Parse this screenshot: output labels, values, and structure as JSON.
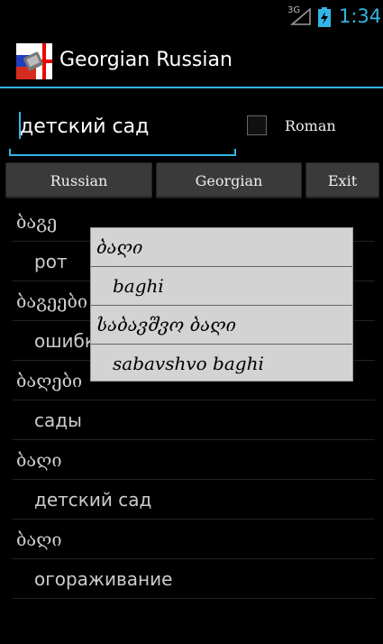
{
  "status_bar": {
    "network": "3G",
    "time": "1:34",
    "signal_icon": "signal-icon",
    "battery_icon": "battery-charging-icon"
  },
  "app": {
    "title": "Georgian Russian",
    "icon": "app-flag-icon"
  },
  "search": {
    "value": "детский сад",
    "roman_label": "Roman",
    "roman_checked": false
  },
  "buttons": {
    "russian": "Russian",
    "georgian": "Georgian",
    "exit": "Exit"
  },
  "results": [
    {
      "type": "geo",
      "text": "ბაგე"
    },
    {
      "type": "rus",
      "text": "рот"
    },
    {
      "type": "geo",
      "text": "ბაგეები"
    },
    {
      "type": "rus",
      "text": "ошибки"
    },
    {
      "type": "geo",
      "text": "ბაღები"
    },
    {
      "type": "rus",
      "text": "сады"
    },
    {
      "type": "geo",
      "text": "ბაღი"
    },
    {
      "type": "rus",
      "text": "детский сад"
    },
    {
      "type": "geo",
      "text": "ბაღი"
    },
    {
      "type": "rus",
      "text": "огораживание"
    }
  ],
  "popup": [
    {
      "type": "geo",
      "text": "ბაღი"
    },
    {
      "type": "lat",
      "text": "baghi"
    },
    {
      "type": "geo",
      "text": "საბავშვო ბაღი"
    },
    {
      "type": "lat",
      "text": "sabavshvo baghi"
    }
  ],
  "colors": {
    "accent": "#33b5e5",
    "button_bg": "#3a3a3a",
    "popup_bg": "#d3d3d3"
  }
}
